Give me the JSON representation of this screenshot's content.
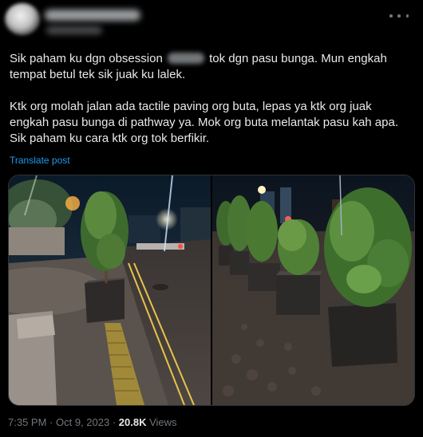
{
  "tweet": {
    "text_before_redaction": "Sik paham ku dgn obsession ",
    "text_after_redaction": " tok dgn pasu bunga. Mun engkah\ntempat betul tek sik juak ku lalek.\n\nKtk org molah jalan ada tactile paving org buta, lepas ya ktk org juak\nengkah pasu bunga di pathway ya. Mok org buta melantak pasu kah apa.\nSik paham ku cara ktk org tok berfikir.",
    "translate_label": "Translate post"
  },
  "footer": {
    "time": "7:35 PM",
    "separator": " · ",
    "date": "Oct 9, 2023",
    "views_count": "20.8K",
    "views_label": " Views"
  },
  "icons": {
    "more": "more-options-icon"
  },
  "colors": {
    "background": "#000000",
    "text": "#e7e9ea",
    "secondary_text": "#71767b",
    "link": "#1d9bf0"
  }
}
